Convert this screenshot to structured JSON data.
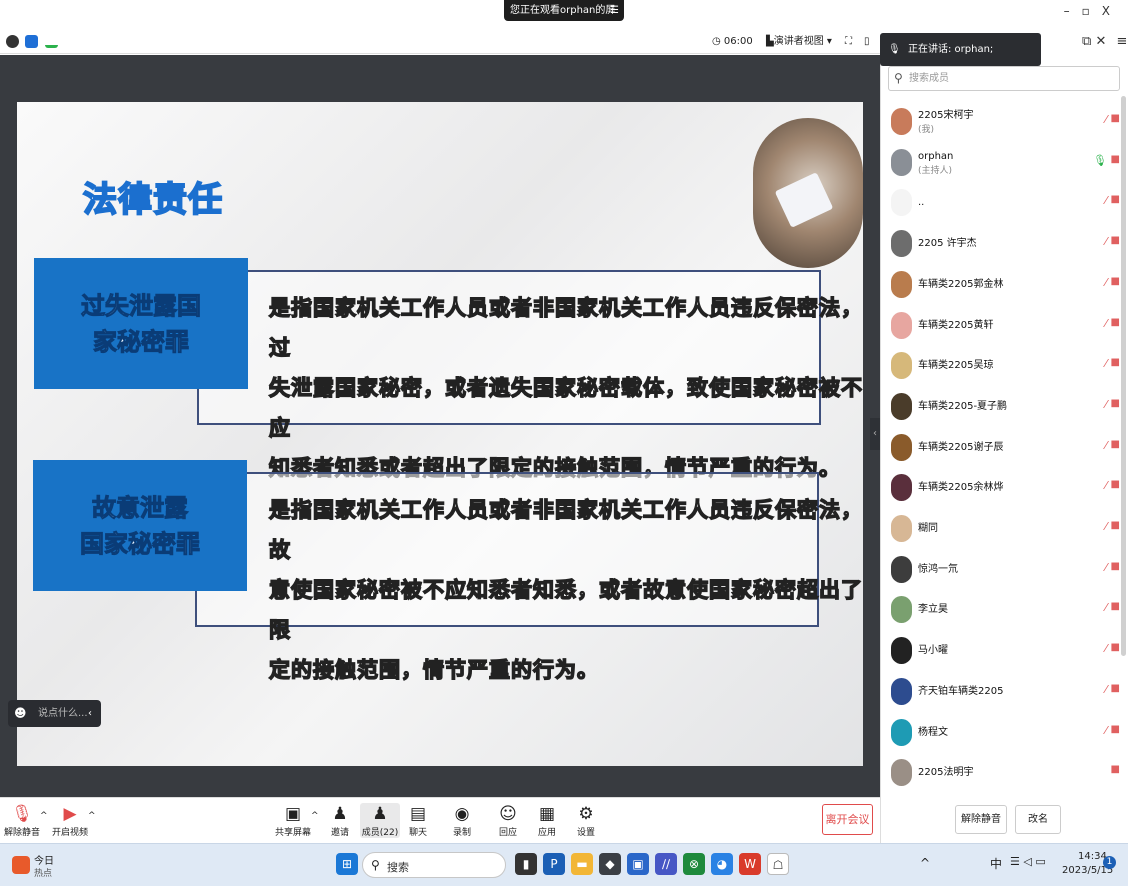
{
  "banner": {
    "text": "您正在观看orphan的屏幕",
    "menu_icon": "menu-icon"
  },
  "window_controls": {
    "min": "–",
    "restore": "▫",
    "close": "X"
  },
  "toolbar": {
    "timer": "06:00",
    "view_label": "演讲者视图",
    "view_caret": "▾"
  },
  "slide": {
    "title": "法律责任",
    "item1": {
      "heading_line1": "过失泄露国",
      "heading_line2": "家秘密罪",
      "body_line1": "是指国家机关工作人员或者非国家机关工作人员违反保密法，过",
      "body_line2": "失泄露国家秘密，或者遗失国家秘密载体，致使国家秘密被不应",
      "body_line3": "知悉者知悉或者超出了限定的接触范围，情节严重的行为。"
    },
    "item2": {
      "heading_line1": "故意泄露",
      "heading_line2": "国家秘密罪",
      "body_line1": "是指国家机关工作人员或者非国家机关工作人员违反保密法，故",
      "body_line2": "意使国家秘密被不应知悉者知悉，或者故意使国家秘密超出了限",
      "body_line3": "定的接触范围，情节严重的行为。"
    }
  },
  "chat_input": {
    "placeholder": "说点什么..."
  },
  "meeting_bar": {
    "unmute": "解除静音",
    "start_video": "开启视频",
    "share": "共享屏幕",
    "invite": "邀请",
    "members": "成员(22)",
    "chat": "聊天",
    "record": "录制",
    "reactions": "回应",
    "apps": "应用",
    "settings": "设置",
    "leave": "离开会议"
  },
  "panel": {
    "speaking": "正在讲话: orphan;",
    "search_placeholder": "搜索成员",
    "members": [
      {
        "name": "2205宋柯宇",
        "sub": "(我)",
        "color": "#c87b5b"
      },
      {
        "name": "orphan",
        "sub": "(主持人)",
        "color": "#8a8f96"
      },
      {
        "name": "..",
        "sub": "",
        "color": "#f4f4f4"
      },
      {
        "name": "2205 许宇杰",
        "sub": "",
        "color": "#6d6d6d"
      },
      {
        "name": "车辆类2205郭金林",
        "sub": "",
        "color": "#b97c4d"
      },
      {
        "name": "车辆类2205黄轩",
        "sub": "",
        "color": "#e7a6a0"
      },
      {
        "name": "车辆类2205吴琼",
        "sub": "",
        "color": "#d6b87a"
      },
      {
        "name": "车辆类2205-夏子鹏",
        "sub": "",
        "color": "#4a3c2a"
      },
      {
        "name": "车辆类2205谢子辰",
        "sub": "",
        "color": "#8a5b2b"
      },
      {
        "name": "车辆类2205余林烨",
        "sub": "",
        "color": "#5a2f3c"
      },
      {
        "name": "糊同",
        "sub": "",
        "color": "#d7b795"
      },
      {
        "name": "惊鸿一氘",
        "sub": "",
        "color": "#3d3d3d"
      },
      {
        "name": "李立昊",
        "sub": "",
        "color": "#7aa06f"
      },
      {
        "name": "马小曜",
        "sub": "",
        "color": "#222"
      },
      {
        "name": "齐天铂车辆类2205",
        "sub": "",
        "color": "#2d4c8f"
      },
      {
        "name": "杨程文",
        "sub": "",
        "color": "#1e9bb4"
      },
      {
        "name": "2205法明宇",
        "sub": "",
        "color": "#9a8f86"
      }
    ],
    "unmute_btn": "解除静音",
    "rename_btn": "改名"
  },
  "taskbar": {
    "weather_title": "今日",
    "weather_sub": "热点",
    "search": "搜索",
    "ime": "中",
    "time": "14:34",
    "date": "2023/5/15",
    "notif_count": "1"
  }
}
